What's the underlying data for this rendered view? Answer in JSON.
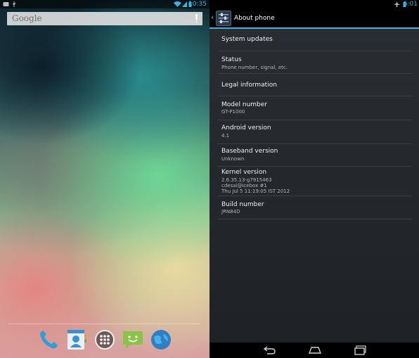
{
  "left_screen": {
    "status_bar": {
      "time": "10:35",
      "icons": [
        "notification-icon",
        "usb-icon",
        "wifi-icon",
        "signal-icon",
        "battery-icon"
      ]
    },
    "search": {
      "logo_text": "Google",
      "icon": "mic-icon"
    },
    "dock": {
      "icons": [
        "phone-icon",
        "contacts-icon",
        "app-drawer-icon",
        "messaging-icon",
        "browser-icon"
      ]
    }
  },
  "right_screen": {
    "status_bar": {
      "time": "6:01",
      "icons": [
        "airplane-icon",
        "battery-icon"
      ]
    },
    "action_bar": {
      "title": "About phone",
      "icon": "settings-icon",
      "back_icon": "back-caret-icon"
    },
    "items": [
      {
        "title": "System updates",
        "lines": []
      },
      {
        "title": "Status",
        "lines": [
          "Phone number, signal, etc."
        ]
      },
      {
        "title": "Legal information",
        "lines": []
      },
      {
        "title": "Model number",
        "lines": [
          "GT-P1000"
        ]
      },
      {
        "title": "Android version",
        "lines": [
          "4.1"
        ]
      },
      {
        "title": "Baseband version",
        "lines": [
          "Unknown"
        ]
      },
      {
        "title": "Kernel version",
        "lines": [
          "2.6.35.13-g7915463",
          "cdesai@icebox #1",
          "Thu Jul 5 11:19:05 IST 2012"
        ]
      },
      {
        "title": "Build number",
        "lines": [
          "JRN84D"
        ]
      }
    ],
    "nav_bar": {
      "icons": [
        "back-icon",
        "home-icon",
        "recent-apps-icon"
      ]
    }
  },
  "colors": {
    "accent": "#33b5e5",
    "list_bg": "#26292d",
    "divider": "#3b3f44"
  }
}
